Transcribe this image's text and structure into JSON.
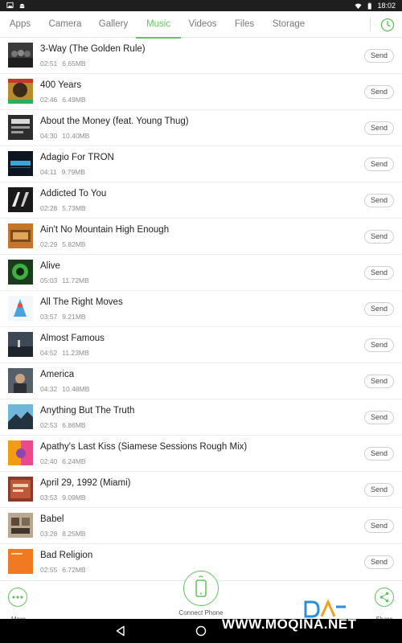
{
  "status_bar": {
    "time": "18:02"
  },
  "tabs": [
    {
      "label": "Apps",
      "active": false
    },
    {
      "label": "Camera",
      "active": false
    },
    {
      "label": "Gallery",
      "active": false
    },
    {
      "label": "Music",
      "active": true
    },
    {
      "label": "Videos",
      "active": false
    },
    {
      "label": "Files",
      "active": false
    },
    {
      "label": "Storage",
      "active": false
    }
  ],
  "history_icon": "clock-icon",
  "send_label": "Send",
  "tracks": [
    {
      "title": "3-Way (The Golden Rule)",
      "duration": "02:51",
      "size": "6.65MB"
    },
    {
      "title": "400 Years",
      "duration": "02:46",
      "size": "6.49MB"
    },
    {
      "title": "About the Money (feat. Young Thug)",
      "duration": "04:30",
      "size": "10.40MB"
    },
    {
      "title": "Adagio For TRON",
      "duration": "04:11",
      "size": "9.79MB"
    },
    {
      "title": "Addicted To You",
      "duration": "02:28",
      "size": "5.73MB"
    },
    {
      "title": "Ain't No Mountain High Enough",
      "duration": "02:29",
      "size": "5.82MB"
    },
    {
      "title": "Alive",
      "duration": "05:03",
      "size": "11.72MB"
    },
    {
      "title": "All The Right Moves",
      "duration": "03:57",
      "size": "9.21MB"
    },
    {
      "title": "Almost Famous",
      "duration": "04:52",
      "size": "11.23MB"
    },
    {
      "title": "America",
      "duration": "04:32",
      "size": "10.48MB"
    },
    {
      "title": "Anything But The Truth",
      "duration": "02:53",
      "size": "6.86MB"
    },
    {
      "title": "Apathy's Last Kiss (Siamese Sessions Rough Mix)",
      "duration": "02:40",
      "size": "6.24MB"
    },
    {
      "title": "April 29, 1992 (Miami)",
      "duration": "03:53",
      "size": "9.09MB"
    },
    {
      "title": "Babel",
      "duration": "03:28",
      "size": "8.25MB"
    },
    {
      "title": "Bad Religion",
      "duration": "02:55",
      "size": "6.72MB"
    }
  ],
  "bottom_bar": {
    "more_label": "More",
    "connect_label": "Connect Phone",
    "share_label": "Share"
  },
  "watermark": "WWW.MOQINA.NET",
  "colors": {
    "accent": "#63c25b",
    "status_bar": "#1f1f1f",
    "nav_bar": "#000000"
  }
}
